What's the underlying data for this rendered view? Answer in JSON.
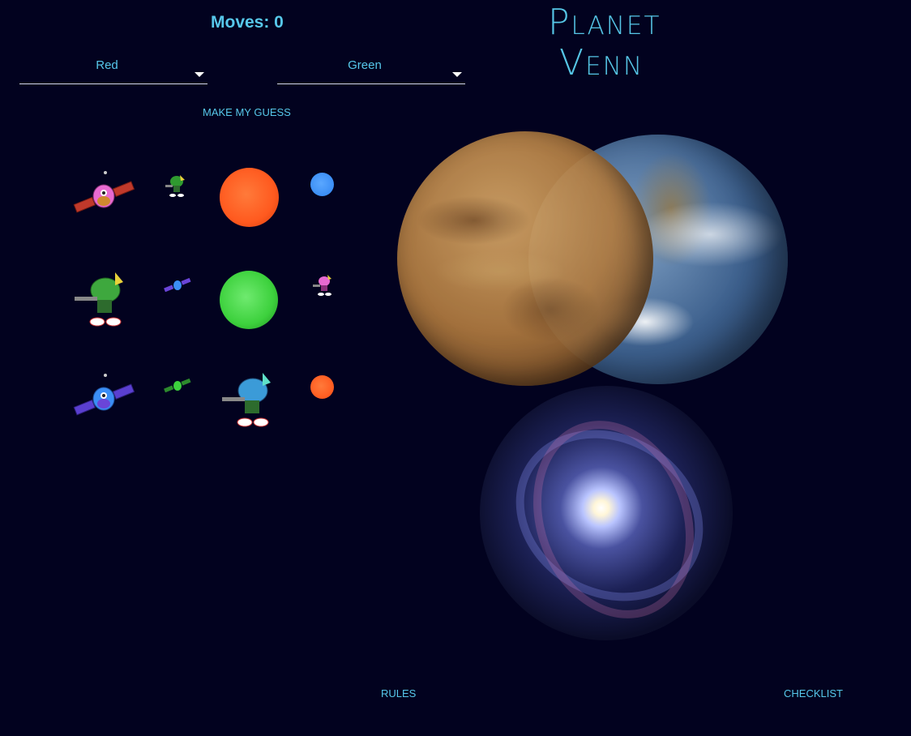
{
  "header": {
    "moves_label": "Moves: 0"
  },
  "title": {
    "line1": "Planet",
    "line2": "Venn"
  },
  "selects": {
    "first": "Red",
    "second": "Green"
  },
  "buttons": {
    "guess": "MAKE MY GUESS",
    "rules": "RULES",
    "checklist": "CHECKLIST"
  },
  "colors": {
    "background": "#02021f",
    "accent": "#57c8ea",
    "red": "#ff5a1f",
    "green": "#3dd13d",
    "blue": "#3b8ef5",
    "pink": "#e86ad1",
    "purple": "#6a45d8"
  },
  "pieces": [
    {
      "name": "pink-satellite-piece",
      "icon": "satellite-icon",
      "color": "pink"
    },
    {
      "name": "small-green-martian-piece",
      "icon": "martian-icon",
      "color": "green"
    },
    {
      "name": "big-red-sun-piece",
      "icon": "sun-icon",
      "color": "red"
    },
    {
      "name": "small-blue-sun-piece",
      "icon": "sun-icon",
      "color": "blue"
    },
    {
      "name": "big-green-martian-piece",
      "icon": "martian-icon",
      "color": "green"
    },
    {
      "name": "small-blue-satellite-piece",
      "icon": "satellite-icon",
      "color": "blue"
    },
    {
      "name": "big-green-sun-piece",
      "icon": "sun-icon",
      "color": "green"
    },
    {
      "name": "small-pink-martian-piece",
      "icon": "martian-icon",
      "color": "pink"
    },
    {
      "name": "blue-satellite-piece",
      "icon": "satellite-icon",
      "color": "blue"
    },
    {
      "name": "small-green-satellite-piece",
      "icon": "satellite-icon",
      "color": "green"
    },
    {
      "name": "big-blue-martian-piece",
      "icon": "martian-icon",
      "color": "blue"
    },
    {
      "name": "small-red-sun-piece",
      "icon": "sun-icon",
      "color": "red"
    }
  ],
  "venn": {
    "circles": [
      "venus-circle",
      "earth-circle",
      "galaxy-circle"
    ]
  }
}
